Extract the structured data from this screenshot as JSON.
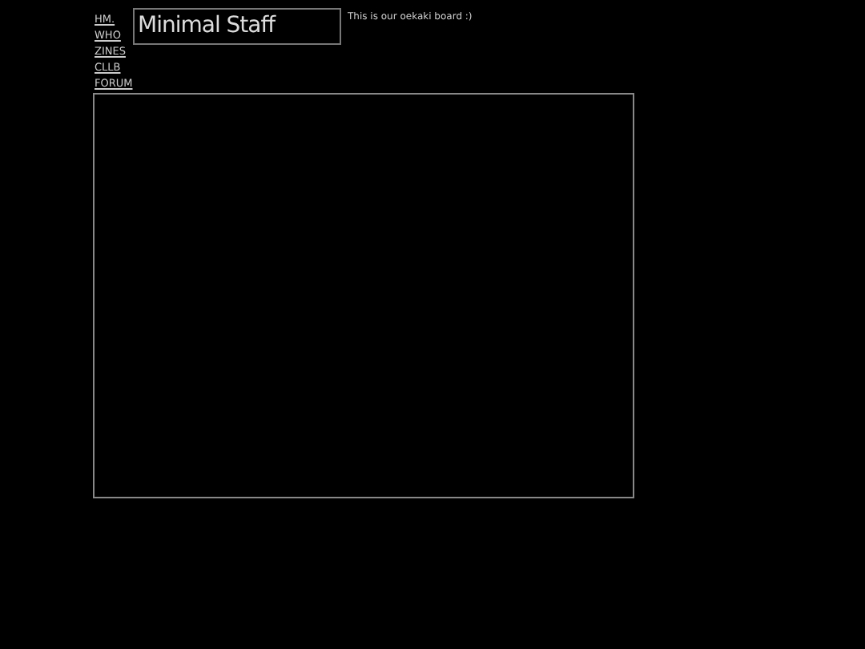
{
  "nav": [
    {
      "label": "HM."
    },
    {
      "label": "WHO"
    },
    {
      "label": "ZINES"
    },
    {
      "label": "CLLB"
    },
    {
      "label": "FORUM"
    }
  ],
  "site_title": "Minimal Staff",
  "intro": "This is our oekaki board :)"
}
